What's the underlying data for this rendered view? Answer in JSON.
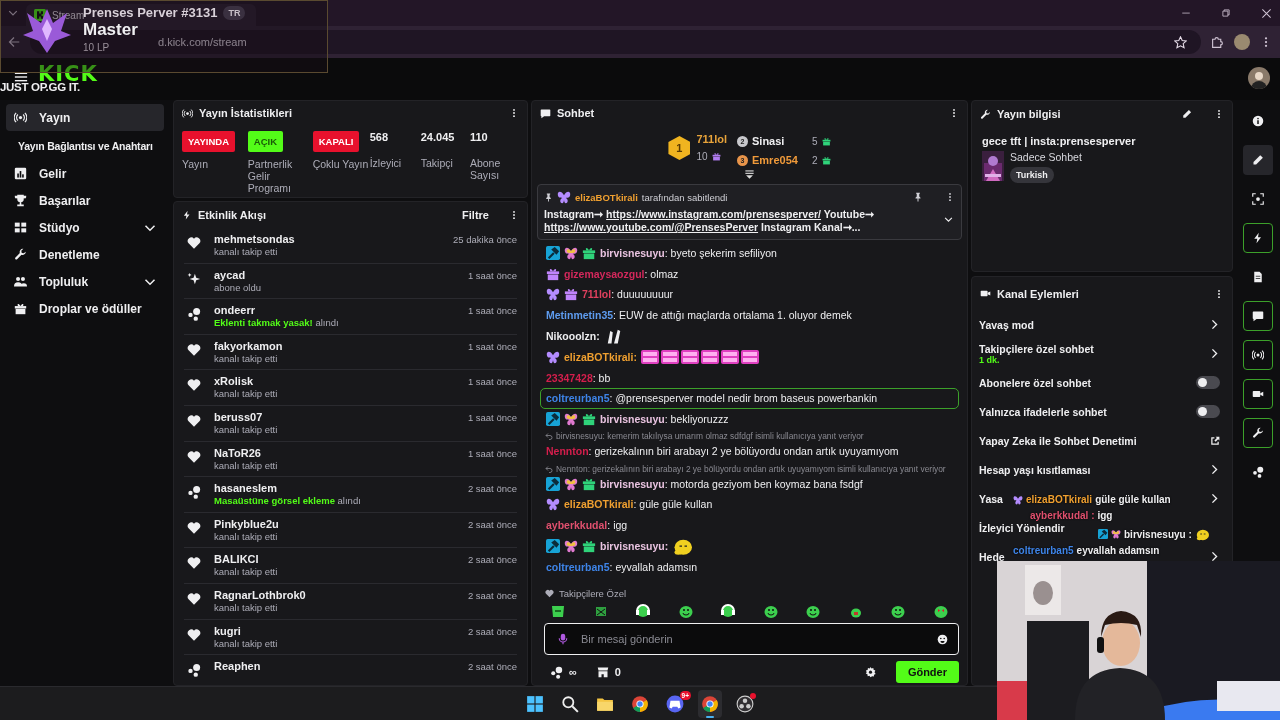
{
  "browser": {
    "tab_title": "Stream",
    "url": "d.kick.com/stream"
  },
  "header": {
    "logo": "KICK"
  },
  "sidebar": {
    "items": [
      {
        "label": "Yayın",
        "kind": "stream",
        "selected": true,
        "children": [
          {
            "label": "Yayın Bağlantısı ve Anahtarı",
            "selected": false
          }
        ]
      },
      {
        "label": "Gelir",
        "kind": "chart",
        "selected": false
      },
      {
        "label": "Başarılar",
        "kind": "trophy",
        "selected": false
      },
      {
        "label": "Stüdyo",
        "kind": "grid",
        "selected": false,
        "expanded": false
      },
      {
        "label": "Denetleme",
        "kind": "wrench",
        "selected": false
      },
      {
        "label": "Topluluk",
        "kind": "people",
        "selected": false,
        "expanded": false
      },
      {
        "label": "Droplar ve ödüller",
        "kind": "gift",
        "selected": false
      }
    ]
  },
  "stats": {
    "title": "Yayın İstatistikleri",
    "items": [
      {
        "kind": "badge",
        "value": "YAYINDA",
        "color": "#e8112d",
        "label": "Yayın"
      },
      {
        "kind": "badge",
        "value": "AÇIK",
        "color": "#53fc18",
        "label": "Partnerlik Gelir Programı"
      },
      {
        "kind": "badge",
        "value": "KAPALI",
        "color": "#e8112d",
        "label": "Çoklu Yayın"
      },
      {
        "kind": "count",
        "value": "568",
        "label": "İzleyici"
      },
      {
        "kind": "count",
        "value": "24.045",
        "label": "Takipçi"
      },
      {
        "kind": "count",
        "value": "110",
        "label": "Abone Sayısı"
      }
    ]
  },
  "feed": {
    "title": "Etkinlik Akışı",
    "filter": "Filtre",
    "events": [
      {
        "kind": "follow",
        "user": "mehmetsondas",
        "detail": "kanalı takip etti",
        "time": "25 dakika önce"
      },
      {
        "kind": "subscribe",
        "user": "aycad",
        "detail": "abone oldu",
        "time": "1 saat önce"
      },
      {
        "kind": "reward",
        "user": "ondeerr",
        "detail": "**Eklenti takmak yasak!** alındı",
        "time": "1 saat önce"
      },
      {
        "kind": "follow",
        "user": "fakyorkamon",
        "detail": "kanalı takip etti",
        "time": "1 saat önce"
      },
      {
        "kind": "follow",
        "user": "xRolisk",
        "detail": "kanalı takip etti",
        "time": "1 saat önce"
      },
      {
        "kind": "follow",
        "user": "beruss07",
        "detail": "kanalı takip etti",
        "time": "1 saat önce"
      },
      {
        "kind": "follow",
        "user": "NaToR26",
        "detail": "kanalı takip etti",
        "time": "1 saat önce"
      },
      {
        "kind": "reward",
        "user": "hasaneslem",
        "detail": "**Masaüstüne görsel ekleme** alındı",
        "time": "2 saat önce"
      },
      {
        "kind": "follow",
        "user": "Pinkyblue2u",
        "detail": "kanalı takip etti",
        "time": "2 saat önce"
      },
      {
        "kind": "follow",
        "user": "BALIKCI",
        "detail": "kanalı takip etti",
        "time": "2 saat önce"
      },
      {
        "kind": "follow",
        "user": "RagnarLothbrok0",
        "detail": "kanalı takip etti",
        "time": "2 saat önce"
      },
      {
        "kind": "follow",
        "user": "kugri",
        "detail": "kanalı takip etti",
        "time": "2 saat önce"
      },
      {
        "kind": "reward",
        "user": "Reaphen",
        "time": "2 saat önce"
      }
    ]
  },
  "chat": {
    "title": "Sohbet",
    "leaders": [
      {
        "rank": "1",
        "user": "711lol",
        "gifts": "10",
        "color": "#e8a33a"
      },
      {
        "rank": "2",
        "user": "Sinasi",
        "gifts": "5",
        "color": "#efeff1"
      },
      {
        "rank": "3",
        "user": "Emre054",
        "gifts": "2",
        "color": "#f09a3a"
      }
    ],
    "pinned": {
      "by": "elizaBOTkirali",
      "note": "tarafından sabitlendi",
      "segments": [
        {
          "text": "Instagram➞ ",
          "link": false
        },
        {
          "text": "https://www.instagram.com/prensesperver/",
          "link": true
        },
        {
          "text": " Youtube➞ ",
          "link": false
        },
        {
          "text": "https://www.youtube.com/@PrensesPerver",
          "link": true
        },
        {
          "text": " Instagram Kanal➞...",
          "link": false
        }
      ]
    },
    "messages": [
      {
        "badges": [
          {
            "kind": "mod"
          },
          {
            "kind": "rainbow"
          },
          {
            "kind": "gift"
          }
        ],
        "user": "birvisnesuyu",
        "color": "#e9c3e0",
        "text": ": byeto şekerim sefiliyon",
        "highlighted": false
      },
      {
        "badges": [
          {
            "kind": "giftp"
          }
        ],
        "user": "gizemaysaozgul",
        "color": "#d4285c",
        "text": ": olmaz",
        "highlighted": false
      },
      {
        "badges": [
          {
            "kind": "butterfly"
          },
          {
            "kind": "giftp"
          }
        ],
        "user": "711lol",
        "color": "#e0405e",
        "text": ": duuuuuuuur",
        "highlighted": false
      },
      {
        "user": "Metinmetin35",
        "color": "#5e9cf0",
        "text": ": EUW de attığı maçlarda ortalama 1. oluyor demek",
        "highlighted": false
      },
      {
        "user": "Nikooolzn:",
        "color": "#efeff1",
        "emote": {
          "kind": "hands"
        },
        "highlighted": false
      },
      {
        "badges": [
          {
            "kind": "butterfly"
          }
        ],
        "user": "elizaBOTkirali:",
        "color": "#f0a030",
        "emote": {
          "kind": "kaco"
        },
        "highlighted": false
      },
      {
        "user": "23347428",
        "color": "#d41e4c",
        "text": ": bb",
        "highlighted": false
      },
      {
        "user": "coltreurban5",
        "color": "#3e84e8",
        "text": ": @prensesperver model nedir brom baseus powerbankin",
        "highlighted": true
      },
      {
        "badges": [
          {
            "kind": "mod"
          },
          {
            "kind": "rainbow"
          },
          {
            "kind": "gift"
          }
        ],
        "user": "birvisnesuyu",
        "color": "#e9c3e0",
        "text": ": bekliyoruzzz",
        "highlighted": false
      },
      {
        "reply": "birvisnesuyu: kemerim takılıysa umarım olmaz sdfdgf isimli kullanıcıya yanıt veriyor",
        "user": "Nennton",
        "color": "#d41e4c",
        "text": ": gerizekalının biri arabayı 2 ye bölüyordu ondan artık uyuyamıyom",
        "highlighted": false
      },
      {
        "badges": [
          {
            "kind": "mod"
          },
          {
            "kind": "rainbow"
          },
          {
            "kind": "gift"
          }
        ],
        "reply": "Nennton: gerizekalının biri arabayı 2 ye bölüyordu ondan artık uyuyamıyom isimli kullanıcıya yanıt veriyor",
        "user": "birvisnesuyu",
        "color": "#e9c3e0",
        "text": ": motorda geziyom ben koymaz bana fsdgf",
        "highlighted": false
      },
      {
        "badges": [
          {
            "kind": "butterfly"
          }
        ],
        "user": "elizaBOTkirali",
        "color": "#f0a030",
        "text": ": güle güle kullan",
        "highlighted": false
      },
      {
        "user": "ayberkkudal",
        "color": "#e0506e",
        "text": ": igg",
        "highlighted": false
      },
      {
        "badges": [
          {
            "kind": "mod"
          },
          {
            "kind": "rainbow"
          },
          {
            "kind": "gift"
          }
        ],
        "user": "birvisnesuyu:",
        "color": "#e9c3e0",
        "emote": {
          "kind": "blob"
        },
        "highlighted": false
      },
      {
        "user": "coltreurban5",
        "color": "#3e84e8",
        "text": ": eyvallah adamsın",
        "highlighted": false
      }
    ],
    "emote_section": "Takipçilere Özel",
    "emotes": [
      {
        "kind": "cup"
      },
      {
        "kind": "box"
      },
      {
        "kind": "headset"
      },
      {
        "kind": "smile"
      },
      {
        "kind": "headset"
      },
      {
        "kind": "smile"
      },
      {
        "kind": "smile"
      },
      {
        "kind": "small"
      },
      {
        "kind": "smile"
      },
      {
        "kind": "heart"
      }
    ],
    "input": {
      "placeholder": "Bir mesaj gönderin"
    },
    "points": "∞",
    "store": "0",
    "send": "Gönder"
  },
  "info": {
    "title": "Yayın bilgisi",
    "stream_title": "gece tft | insta:prensesperver",
    "category": "Sadece Sohbet",
    "tag": "Turkish"
  },
  "actions": {
    "title": "Kanal Eylemleri",
    "items": [
      {
        "kind": "link",
        "label": "Yavaş mod"
      },
      {
        "kind": "link",
        "label": "Takipçilere özel sohbet",
        "sub": "1 dk."
      },
      {
        "kind": "toggle",
        "label": "Abonelere özel sohbet",
        "on": false
      },
      {
        "kind": "toggle",
        "label": "Yalnızca ifadelerle sohbet",
        "on": false
      },
      {
        "kind": "external",
        "label": "Yapay Zeka ile Sohbet Denetimi"
      },
      {
        "kind": "link",
        "label": "Hesap yaşı kısıtlaması"
      },
      {
        "kind": "link",
        "label": "Yasa"
      },
      {
        "kind": "plain",
        "label": "İzleyici Yönlendir"
      },
      {
        "kind": "link",
        "label": "Hede"
      }
    ]
  },
  "rail": [
    {
      "kind": "info",
      "on": false,
      "selected": false
    },
    {
      "kind": "pencil",
      "on": false,
      "selected": true
    },
    {
      "kind": "frame",
      "on": false,
      "selected": false
    },
    {
      "kind": "bolt",
      "on": true,
      "selected": false
    },
    {
      "kind": "doc",
      "on": false,
      "selected": false
    },
    {
      "kind": "chat",
      "on": true,
      "selected": false
    },
    {
      "kind": "stream",
      "on": true,
      "selected": false
    },
    {
      "kind": "camera",
      "on": true,
      "selected": false
    },
    {
      "kind": "wrench",
      "on": true,
      "selected": false
    },
    {
      "kind": "dots",
      "on": false,
      "selected": false
    }
  ],
  "overlay": {
    "player": "Prenses Perver #3131",
    "region": "TR",
    "tier": "Master",
    "lp": "10 LP",
    "slogan": "JUST OP.GG IT.",
    "chat": [
      {
        "badges": [
          {
            "kind": "butterfly"
          }
        ],
        "user": "elizaBOTkirali",
        "color": "#f0a030",
        "text": "güle güle kullan"
      },
      {
        "user": "ayberkkudal :",
        "color": "#e0506e",
        "text": "igg"
      },
      {
        "badges": [
          {
            "kind": "mod"
          },
          {
            "kind": "rainbow"
          }
        ],
        "user": "birvisnesuyu :",
        "color": "#efeff1",
        "emote": {
          "kind": "blob"
        }
      },
      {
        "user": "coltreurban5",
        "color": "#3e84e8",
        "text": "eyvallah adamsın"
      }
    ]
  },
  "taskbar": {
    "apps": [
      {
        "kind": "windows",
        "active": false,
        "alert": false
      },
      {
        "kind": "search",
        "active": false,
        "alert": false
      },
      {
        "kind": "folder",
        "active": false,
        "alert": false
      },
      {
        "kind": "chrome",
        "active": false,
        "alert": false
      },
      {
        "kind": "discord",
        "badge": "9+",
        "active": false,
        "alert": false
      },
      {
        "kind": "chrome",
        "active": true,
        "alert": false
      },
      {
        "kind": "obs",
        "active": false,
        "alert": true
      }
    ]
  }
}
